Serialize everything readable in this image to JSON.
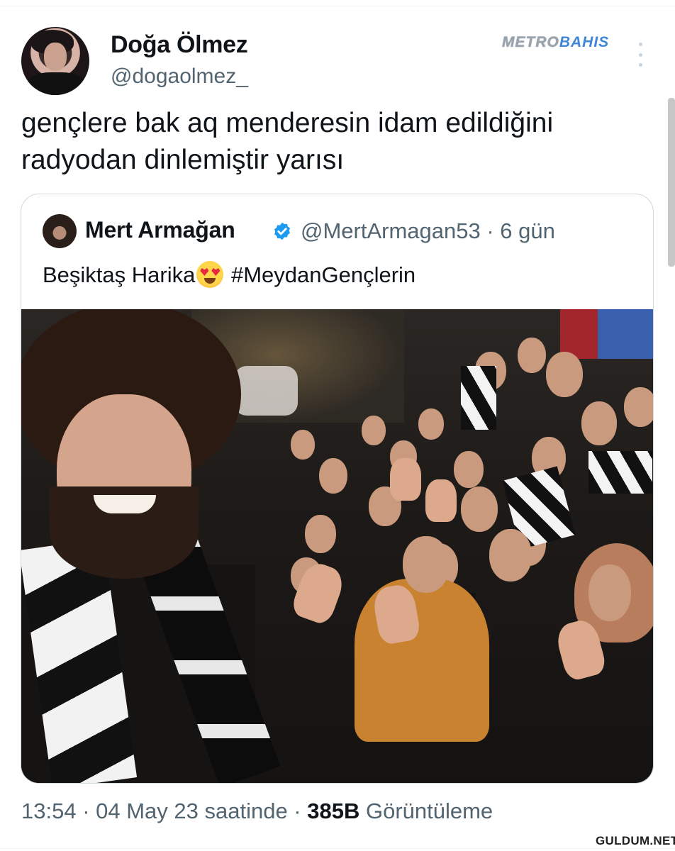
{
  "author": {
    "display_name": "Doğa Ölmez",
    "handle": "@dogaolmez_"
  },
  "watermark": {
    "part_a": "METRO",
    "part_b": "BAHIS"
  },
  "tweet": {
    "text": "gençlere bak aq menderesin idam edildiğini radyodan dinlemiştir yarısı"
  },
  "quoted_tweet": {
    "display_name": "Mert Armağan",
    "verified": true,
    "handle_and_time": "@MertArmagan53 · 6 gün",
    "text_before_emoji": "Beşiktaş Harika",
    "emoji_name": "smiling-face-with-heart-eyes",
    "text_after_emoji": " #MeydanGençlerin"
  },
  "footer": {
    "time": "13:54 · 04 May 23 saatinde · ",
    "views_count": "385B",
    "views_label": " Görüntüleme"
  },
  "site_watermark": "GULDUM.NET",
  "colors": {
    "secondary_text": "#536471",
    "verified_blue": "#1d9bf0",
    "border": "#cfd9de"
  }
}
